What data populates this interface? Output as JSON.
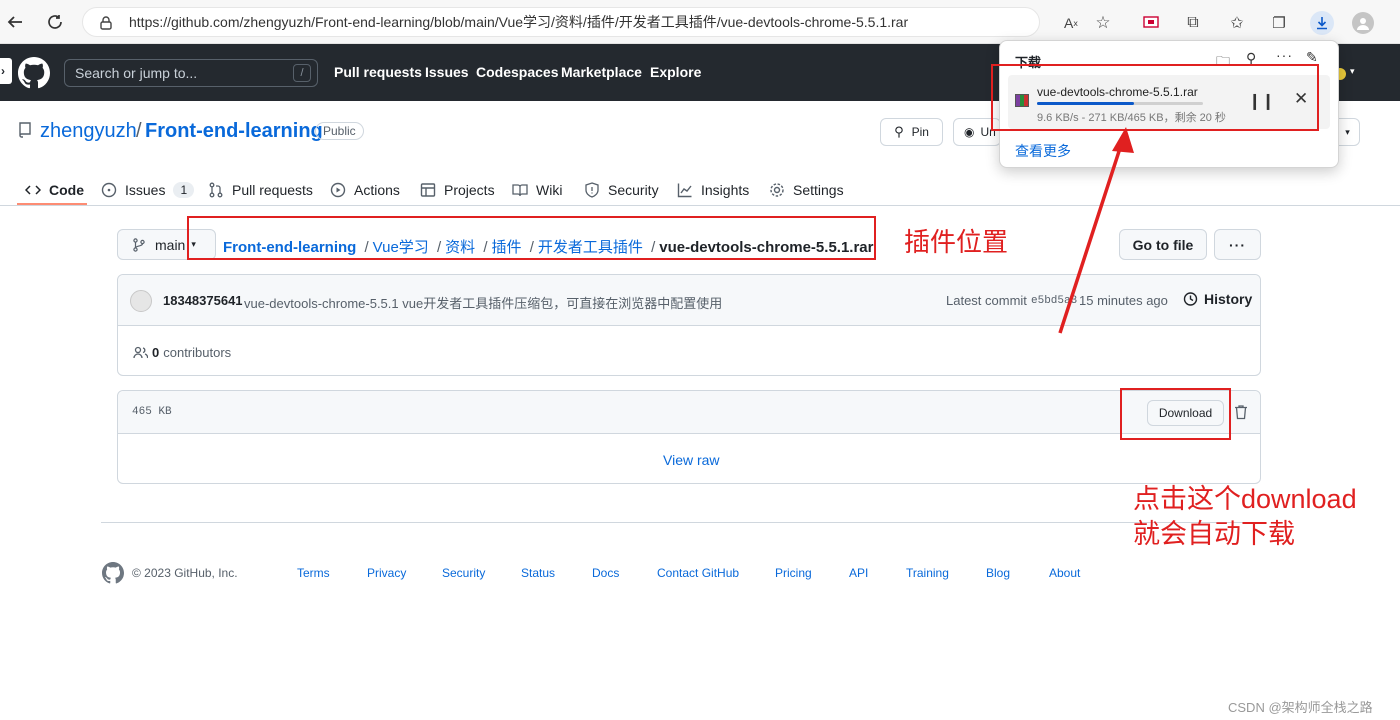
{
  "browser": {
    "url": "https://github.com/zhengyuzh/Front-end-learning/blob/main/Vue学习/资料/插件/开发者工具插件/vue-devtools-chrome-5.5.1.rar"
  },
  "header": {
    "search_placeholder": "Search or jump to...",
    "search_shortcut": "/",
    "links": [
      "Pull requests",
      "Issues",
      "Codespaces",
      "Marketplace",
      "Explore"
    ]
  },
  "repo": {
    "owner": "zhengyuzh",
    "separator": "/",
    "name": "Front-end-learning",
    "visibility": "Public",
    "pin_label": "Pin",
    "watch_label": "Un"
  },
  "tabs": [
    {
      "label": "Code",
      "icon": "code-icon"
    },
    {
      "label": "Issues",
      "icon": "issue-icon",
      "count": "1"
    },
    {
      "label": "Pull requests",
      "icon": "pull-request-icon"
    },
    {
      "label": "Actions",
      "icon": "play-icon"
    },
    {
      "label": "Projects",
      "icon": "table-icon"
    },
    {
      "label": "Wiki",
      "icon": "book-icon"
    },
    {
      "label": "Security",
      "icon": "shield-icon"
    },
    {
      "label": "Insights",
      "icon": "graph-icon"
    },
    {
      "label": "Settings",
      "icon": "gear-icon"
    }
  ],
  "file": {
    "branch": "main",
    "breadcrumb": [
      "Front-end-learning",
      "Vue学习",
      "资料",
      "插件",
      "开发者工具插件"
    ],
    "breadcrumb_sep": "/",
    "filename": "vue-devtools-chrome-5.5.1.rar",
    "go_to_file": "Go to file",
    "more": "···",
    "commit_author": "18348375641",
    "commit_message": "vue-devtools-chrome-5.5.1 vue开发者工具插件压缩包，可直接在浏览器中配置使用",
    "latest_commit_label": "Latest commit",
    "commit_hash": "e5bd5a3",
    "commit_time": "15 minutes ago",
    "history_label": "History",
    "contributors_count": "0",
    "contributors_label": "contributors",
    "size": "465 KB",
    "download_label": "Download",
    "view_raw": "View raw"
  },
  "footer": {
    "copyright": "© 2023 GitHub, Inc.",
    "links": [
      "Terms",
      "Privacy",
      "Security",
      "Status",
      "Docs",
      "Contact GitHub",
      "Pricing",
      "API",
      "Training",
      "Blog",
      "About"
    ]
  },
  "download_panel": {
    "title": "下载",
    "file_name": "vue-devtools-chrome-5.5.1.rar",
    "status": "9.6 KB/s - 271 KB/465 KB，剩余 20 秒",
    "progress": 0.583,
    "see_more": "查看更多"
  },
  "annotations": {
    "plugin_location": "插件位置",
    "click_download_1": "点击这个download",
    "click_download_2": "就会自动下载"
  },
  "watermark": "CSDN @架构师全栈之路",
  "colors": {
    "header_bg": "#24292f",
    "link": "#0969da",
    "annotation": "#e02020",
    "tab_underline": "#fd8c73"
  }
}
